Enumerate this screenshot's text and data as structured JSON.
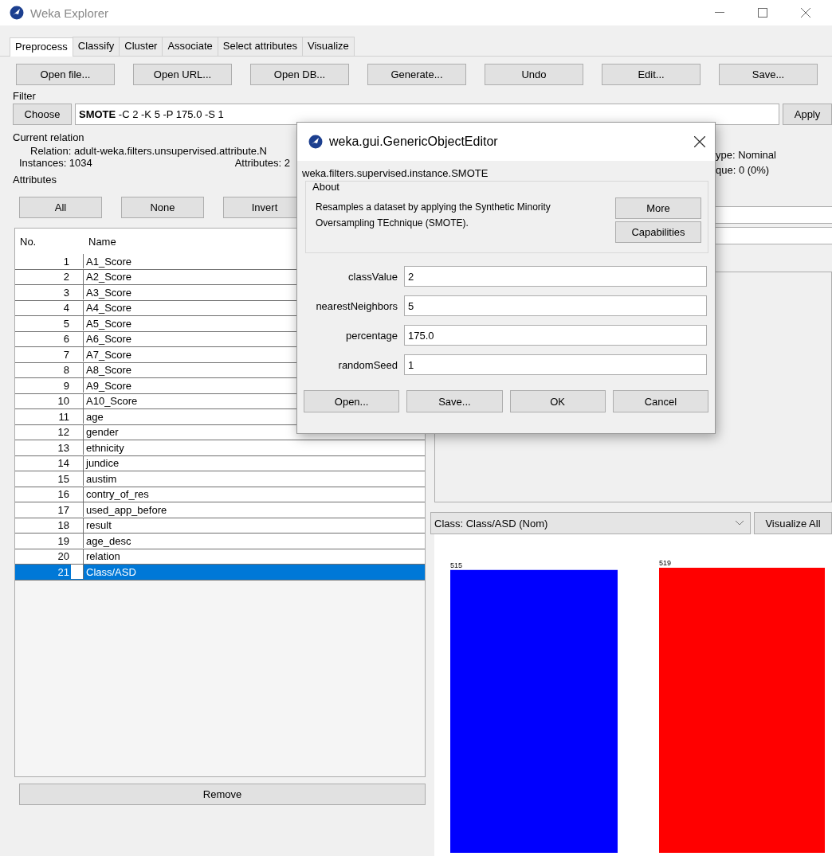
{
  "window": {
    "title": "Weka Explorer"
  },
  "tabs": [
    {
      "label": "Preprocess",
      "selected": true
    },
    {
      "label": "Classify",
      "selected": false
    },
    {
      "label": "Cluster",
      "selected": false
    },
    {
      "label": "Associate",
      "selected": false
    },
    {
      "label": "Select attributes",
      "selected": false
    },
    {
      "label": "Visualize",
      "selected": false
    }
  ],
  "toolbar": [
    "Open file...",
    "Open URL...",
    "Open DB...",
    "Generate...",
    "Undo",
    "Edit...",
    "Save..."
  ],
  "filter": {
    "title": "Filter",
    "choose": "Choose",
    "name": "SMOTE",
    "options": "-C 2 -K 5 -P 175.0 -S 1",
    "apply": "Apply"
  },
  "current_relation": {
    "title": "Current relation",
    "relation": "Relation: adult-weka.filters.unsupervised.attribute.N",
    "instances": "Instances: 1034",
    "attributes": "Attributes: 2"
  },
  "attributes": {
    "title": "Attributes",
    "buttons": [
      "All",
      "None",
      "Invert"
    ],
    "columns": [
      "No.",
      "Name"
    ],
    "rows": [
      {
        "no": "1",
        "name": "A1_Score",
        "checked": false,
        "selected": false
      },
      {
        "no": "2",
        "name": "A2_Score",
        "checked": false,
        "selected": false
      },
      {
        "no": "3",
        "name": "A3_Score",
        "checked": false,
        "selected": false
      },
      {
        "no": "4",
        "name": "A4_Score",
        "checked": false,
        "selected": false
      },
      {
        "no": "5",
        "name": "A5_Score",
        "checked": false,
        "selected": false
      },
      {
        "no": "6",
        "name": "A6_Score",
        "checked": false,
        "selected": false
      },
      {
        "no": "7",
        "name": "A7_Score",
        "checked": false,
        "selected": false
      },
      {
        "no": "8",
        "name": "A8_Score",
        "checked": false,
        "selected": false
      },
      {
        "no": "9",
        "name": "A9_Score",
        "checked": false,
        "selected": false
      },
      {
        "no": "10",
        "name": "A10_Score",
        "checked": false,
        "selected": false
      },
      {
        "no": "11",
        "name": "age",
        "checked": false,
        "selected": false
      },
      {
        "no": "12",
        "name": "gender",
        "checked": false,
        "selected": false
      },
      {
        "no": "13",
        "name": "ethnicity",
        "checked": false,
        "selected": false
      },
      {
        "no": "14",
        "name": "jundice",
        "checked": false,
        "selected": false
      },
      {
        "no": "15",
        "name": "austim",
        "checked": false,
        "selected": false
      },
      {
        "no": "16",
        "name": "contry_of_res",
        "checked": false,
        "selected": false
      },
      {
        "no": "17",
        "name": "used_app_before",
        "checked": false,
        "selected": false
      },
      {
        "no": "18",
        "name": "result",
        "checked": false,
        "selected": false
      },
      {
        "no": "19",
        "name": "age_desc",
        "checked": false,
        "selected": false
      },
      {
        "no": "20",
        "name": "relation",
        "checked": false,
        "selected": false
      },
      {
        "no": "21",
        "name": "Class/ASD",
        "checked": false,
        "selected": true
      }
    ],
    "remove": "Remove"
  },
  "selected_attribute": {
    "type": "ype: Nominal",
    "unique": "que: 0 (0%)"
  },
  "visualization": {
    "class_select": "Class: Class/ASD (Nom)",
    "visualize_all": "Visualize All",
    "bars": [
      {
        "count": "515",
        "color": "#0000ff"
      },
      {
        "count": "519",
        "color": "#ff0000"
      }
    ]
  },
  "dialog": {
    "title": "weka.gui.GenericObjectEditor",
    "class_name": "weka.filters.supervised.instance.SMOTE",
    "about": {
      "title": "About",
      "text": "Resamples a dataset by applying the Synthetic Minority Oversampling TEchnique (SMOTE).",
      "buttons": [
        "More",
        "Capabilities"
      ]
    },
    "properties": [
      {
        "label": "classValue",
        "value": "2"
      },
      {
        "label": "nearestNeighbors",
        "value": "5"
      },
      {
        "label": "percentage",
        "value": "175.0"
      },
      {
        "label": "randomSeed",
        "value": "1"
      }
    ],
    "buttons": [
      "Open...",
      "Save...",
      "OK",
      "Cancel"
    ]
  }
}
